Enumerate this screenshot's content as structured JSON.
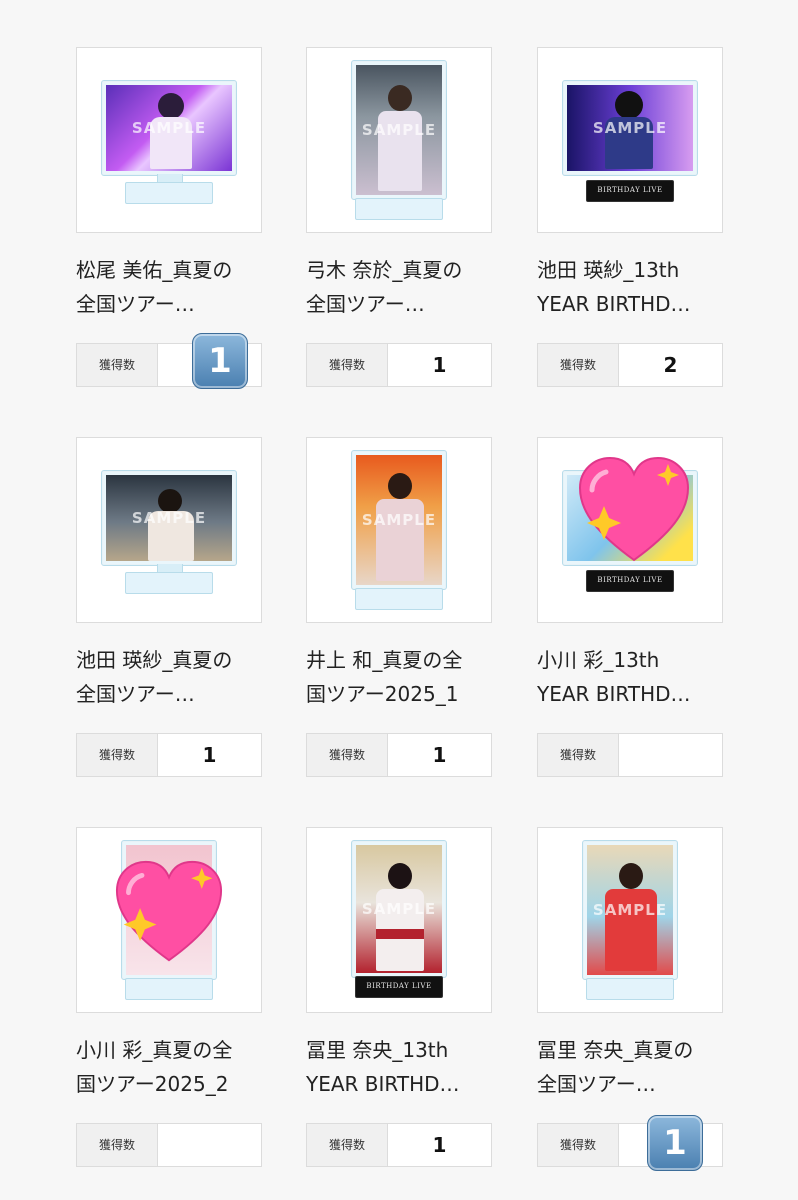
{
  "count_label": "獲得数",
  "sample_text": "SAMPLE",
  "base_text": "BIRTHDAY LIVE",
  "colors": {
    "badge": "#5b8fc2",
    "heart": "#ff4fa3",
    "sparkle": "#ffc928"
  },
  "items": [
    {
      "name": "松尾 美佑_真夏の\n全国ツアー…",
      "count": "",
      "badge": "1"
    },
    {
      "name": "弓木 奈於_真夏の\n全国ツアー…",
      "count": "1"
    },
    {
      "name": "池田 瑛紗_13th\nYEAR BIRTHD…",
      "count": "2"
    },
    {
      "name": "池田 瑛紗_真夏の\n全国ツアー…",
      "count": "1"
    },
    {
      "name": "井上 和_真夏の全\n国ツアー2025_1",
      "count": "1"
    },
    {
      "name": "小川 彩_13th\nYEAR BIRTHD…",
      "count": "",
      "icon": "sparkling-heart-icon"
    },
    {
      "name": "小川 彩_真夏の全\n国ツアー2025_2",
      "count": "",
      "icon": "sparkling-heart-icon"
    },
    {
      "name": "冨里 奈央_13th\nYEAR BIRTHD…",
      "count": "1"
    },
    {
      "name": "冨里 奈央_真夏の\n全国ツアー…",
      "count": "",
      "badge": "1"
    }
  ]
}
